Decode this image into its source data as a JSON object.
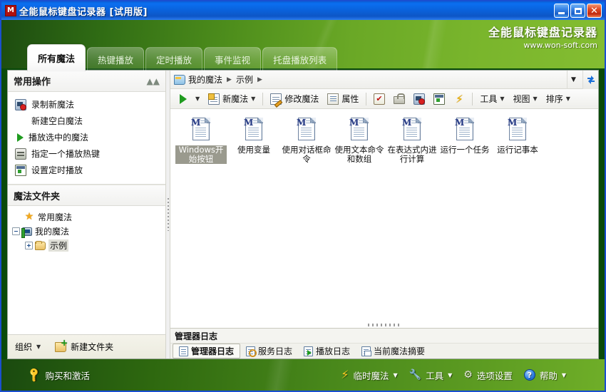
{
  "window": {
    "title": "全能鼠标键盘记录器  [试用版]",
    "app_icon": "M",
    "controls": {
      "minimize": "minimize-icon",
      "maximize": "maximize-icon",
      "close": "✕"
    }
  },
  "banner": {
    "brand_name": "全能鼠标键盘记录器",
    "brand_url": "www.won-soft.com"
  },
  "tabs": [
    {
      "label": "所有魔法",
      "active": true
    },
    {
      "label": "热键播放",
      "active": false
    },
    {
      "label": "定时播放",
      "active": false
    },
    {
      "label": "事件监视",
      "active": false
    },
    {
      "label": "托盘播放列表",
      "active": false
    }
  ],
  "sidebar": {
    "common_ops": {
      "title": "常用操作",
      "collapse_icon": "chevron-up-icon",
      "items": [
        {
          "label": "录制新魔法",
          "icon": "record-icon"
        },
        {
          "label": "新建空白魔法",
          "icon": "none"
        },
        {
          "label": "播放选中的魔法",
          "icon": "play-icon"
        },
        {
          "label": "指定一个播放热键",
          "icon": "keyboard-icon"
        },
        {
          "label": "设置定时播放",
          "icon": "schedule-icon"
        }
      ]
    },
    "folders": {
      "title": "魔法文件夹",
      "tree": [
        {
          "label": "常用魔法",
          "icon": "star-icon",
          "expander": "none",
          "indent": 0,
          "selected": false
        },
        {
          "label": "我的魔法",
          "icon": "computer-icon",
          "expander": "minus",
          "indent": 0,
          "selected": false
        },
        {
          "label": "示例",
          "icon": "folder-icon",
          "expander": "plus",
          "indent": 1,
          "selected": true
        }
      ]
    },
    "footer": {
      "organize_label": "组织",
      "organize_caret": "▼",
      "new_folder_label": "新建文件夹",
      "new_folder_icon": "new-folder-icon"
    }
  },
  "main": {
    "breadcrumb": {
      "folder_icon": "folder-icon",
      "parts": [
        "我的魔法",
        "示例"
      ],
      "arrow": "▶",
      "dropdown": "▼",
      "refresh_icon": "refresh-icon"
    },
    "toolbar": {
      "play_icon": "play-icon",
      "play_caret": "▼",
      "new_magic": "新魔法",
      "new_magic_caret": "▼",
      "edit_magic": "修改魔法",
      "properties": "属性",
      "icon_buttons": [
        "checklist-icon",
        "lock-icon",
        "record-icon",
        "schedule-icon",
        "bolt-icon"
      ],
      "tools": "工具",
      "view": "视图",
      "sort": "排序",
      "caret": "▼"
    },
    "files": [
      {
        "name": "Windows开始按钮",
        "selected": true
      },
      {
        "name": "使用变量",
        "selected": false
      },
      {
        "name": "使用对话框命令",
        "selected": false
      },
      {
        "name": "使用文本命令和数组",
        "selected": false
      },
      {
        "name": "在表达式内进行计算",
        "selected": false
      },
      {
        "name": "运行一个任务",
        "selected": false
      },
      {
        "name": "运行记事本",
        "selected": false
      }
    ],
    "log": {
      "title": "管理器日志",
      "tabs": [
        {
          "label": "管理器日志",
          "icon": "document-icon",
          "active": true
        },
        {
          "label": "服务日志",
          "icon": "service-icon",
          "active": false
        },
        {
          "label": "播放日志",
          "icon": "play-log-icon",
          "active": false
        },
        {
          "label": "当前魔法摘要",
          "icon": "summary-icon",
          "active": false
        }
      ]
    }
  },
  "bottombar": {
    "left": {
      "label": "购买和激活",
      "icon": "key-icon"
    },
    "right": [
      {
        "label": "临时魔法",
        "icon": "bolt-icon",
        "caret": "▼"
      },
      {
        "label": "工具",
        "icon": "wrench-icon",
        "caret": "▼"
      },
      {
        "label": "选项设置",
        "icon": "gears-icon",
        "caret": ""
      },
      {
        "label": "帮助",
        "icon": "help-icon",
        "caret": "▼"
      }
    ]
  },
  "colors": {
    "titlebar_blue": "#0b6ff0",
    "banner_green_dark": "#1d4c10",
    "banner_green_light": "#84bd31",
    "selection_gray": "#9a9a8e",
    "border_blue": "#1a4fd0"
  }
}
